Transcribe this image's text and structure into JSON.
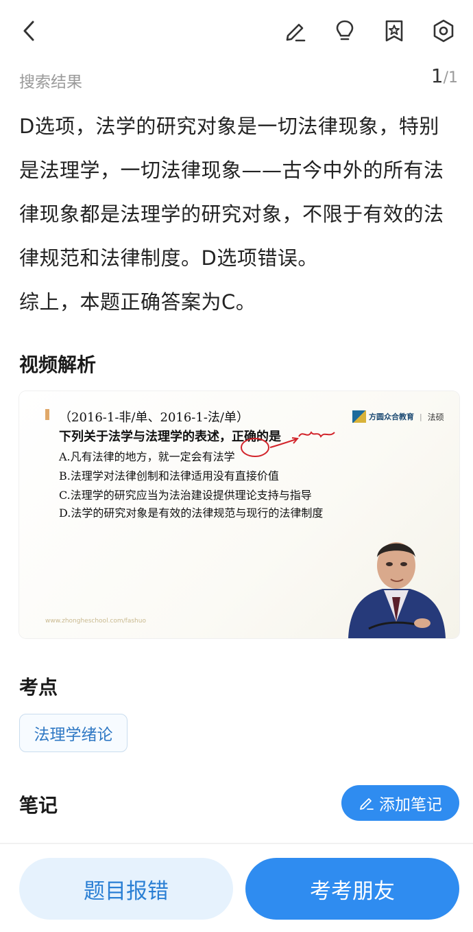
{
  "header": {
    "icons": [
      "back-icon",
      "edit-icon",
      "lightbulb-icon",
      "bookmark-star-icon",
      "settings-icon"
    ]
  },
  "subhead": {
    "crumb": "搜索结果",
    "page_current": "1",
    "page_total": "/1"
  },
  "explanation": {
    "paragraphs": [
      "D选项，法学的研究对象是一切法律现象，特别是法理学，一切法律现象——古今中外的所有法律现象都是法理学的研究对象，不限于有效的法律规范和法律制度。D选项错误。",
      "综上，本题正确答案为C。"
    ]
  },
  "video_section": {
    "title": "视频解析",
    "slide": {
      "header": "（2016-1-非/单、2016-1-法/单）",
      "question": "下列关于法学与法理学的表述，正确的是",
      "options": [
        "A.凡有法律的地方，就一定会有法学",
        "B.法理学对法律创制和法律适用没有直接价值",
        "C.法理学的研究应当为法治建设提供理论支持与指导",
        "D.法学的研究对象是有效的法律规范与现行的法律制度"
      ],
      "logo": "方圆众合教育",
      "logo_sub": "法硕",
      "url": "www.zhongheschool.com/fashuo"
    }
  },
  "knowledge_point": {
    "title": "考点",
    "tag": "法理学绪论"
  },
  "notes": {
    "title": "笔记",
    "add_label": "添加笔记"
  },
  "footer": {
    "report_label": "题目报错",
    "friend_label": "考考朋友"
  },
  "colors": {
    "accent": "#2f8cf0",
    "accent_light": "#e6f2fd",
    "muted_text": "#9a9a9a"
  }
}
